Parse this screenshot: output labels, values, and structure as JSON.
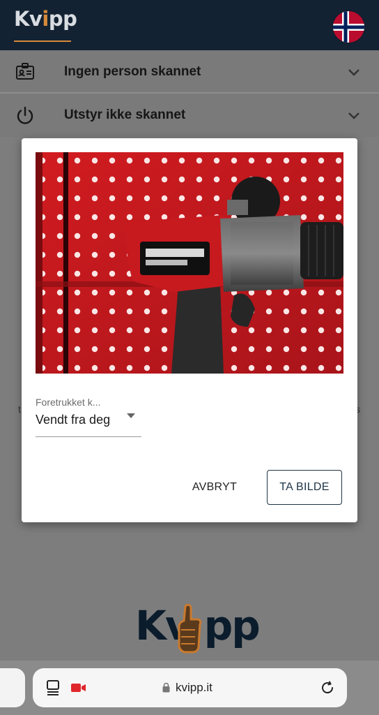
{
  "header": {
    "logo_prefix": "Kv",
    "logo_dot": "i",
    "logo_suffix": "pp",
    "language_icon": "norway-flag-icon"
  },
  "accordion": [
    {
      "label": "Ingen person skannet",
      "icon": "id-card-icon"
    },
    {
      "label": "Utstyr ikke skannet",
      "icon": "power-icon"
    }
  ],
  "background": {
    "edge_left": "t",
    "edge_right": "s",
    "footer_logo_left": "Kv",
    "footer_logo_right": "pp"
  },
  "dialog": {
    "preview_icon": "camera-preview",
    "camera_select": {
      "label": "Foretrukket k...",
      "value": "Vendt fra deg"
    },
    "cancel_label": "AVBRYT",
    "confirm_label": "TA BILDE"
  },
  "browser": {
    "url": "kvipp.it",
    "tabs_icon": "tabs-icon",
    "camera_indicator": "camera-recording-icon",
    "reload_icon": "reload-icon"
  },
  "colors": {
    "header_bg": "#132232",
    "accent": "#d68a3a",
    "overlay": "#7d7d7d",
    "camera_indicator": "#e0262b"
  }
}
